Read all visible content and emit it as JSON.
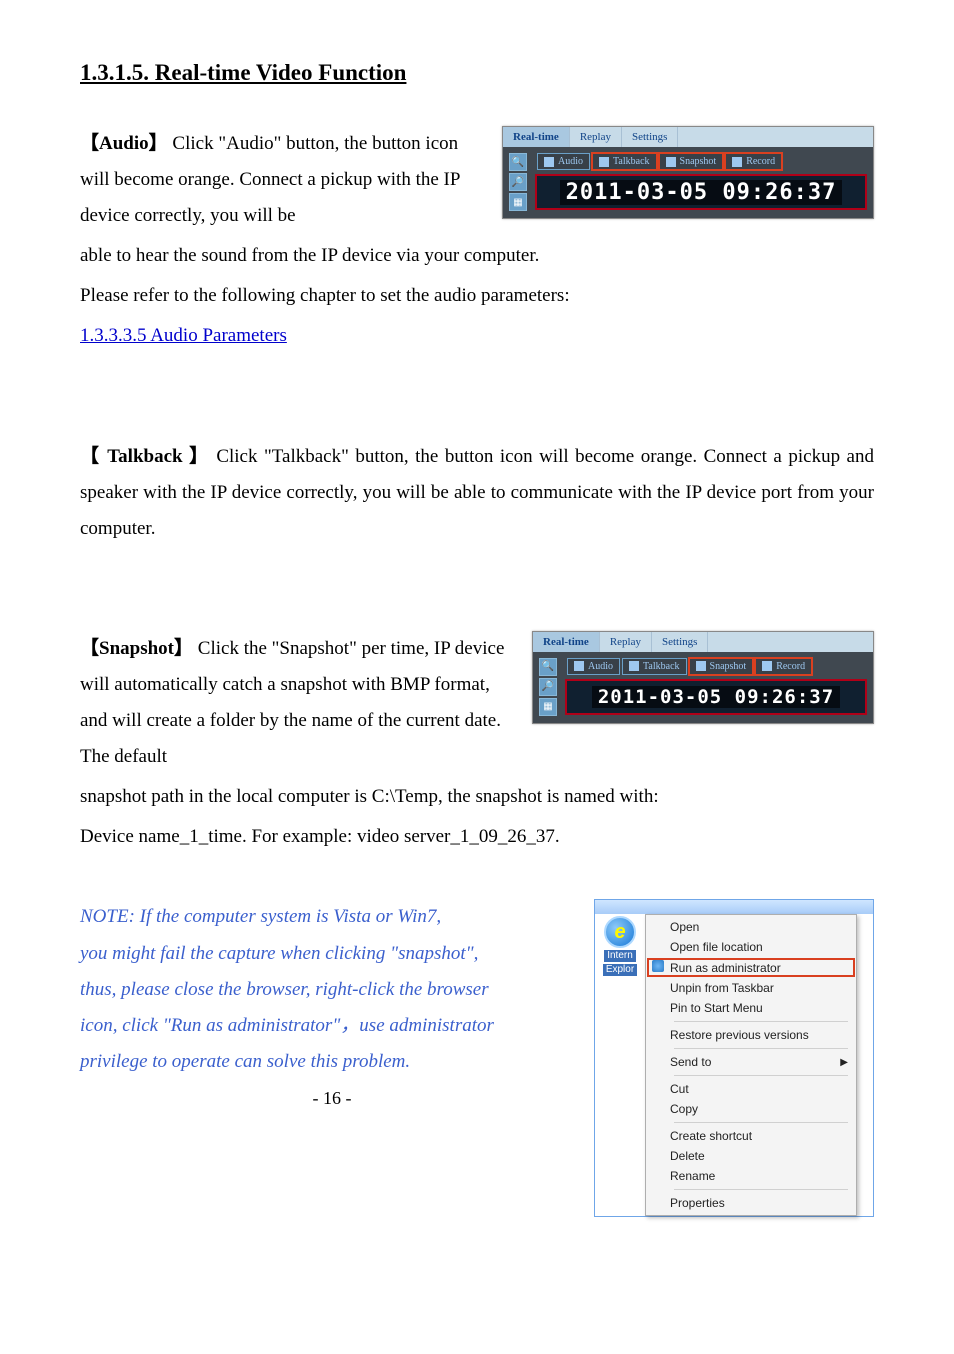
{
  "heading": "1.3.1.5. Real-time Video Function",
  "audio": {
    "label_open": "【",
    "label_text": "Audio",
    "label_close": "】",
    "text1": "Click \"Audio\" button, the button icon will become orange. Connect a pickup with the IP device correctly, you will be",
    "text2": "able to hear the sound from the IP device via your computer.",
    "text3": "Please refer to the following chapter to set the audio parameters:",
    "link": "1.3.3.3.5 Audio Parameters"
  },
  "talkback": {
    "label_open": "【",
    "label_text": " Talkback ",
    "label_close": "】",
    "text": " Click \"Talkback\" button, the button icon will become orange. Connect a pickup and speaker with the IP device correctly, you will be able to communicate with the IP device port from your computer."
  },
  "snapshot": {
    "label_open": "【",
    "label_text": "Snapshot",
    "label_close": "】",
    "text1": "Click the \"Snapshot\" per time,   IP device will automatically catch a snapshot with BMP format, and will create a folder by the name of the current date. The default",
    "text2": "snapshot path in the local computer is C:\\Temp, the snapshot is named with:",
    "text3": "Device name_1_time. For example: video server_1_09_26_37."
  },
  "note": {
    "line1": "NOTE: If the computer system is Vista or Win7,",
    "line2": "you might fail the capture when clicking \"snapshot\",",
    "line3": "thus, please close the browser, right-click the browser",
    "line4": "icon, click \"Run as administrator\"，use administrator",
    "line5": "privilege to operate can solve this problem."
  },
  "page_number": "- 16 -",
  "figure_toolbar": {
    "tabs": {
      "realtime": "Real-time",
      "replay": "Replay",
      "settings": "Settings"
    },
    "buttons": {
      "audio": "Audio",
      "talkback": "Talkback",
      "snapshot": "Snapshot",
      "record": "Record"
    },
    "timestamp": "2011-03-05 09:26:37"
  },
  "context_menu": {
    "ie_label1": "Intern",
    "ie_label2": "Explor",
    "items": {
      "open": "Open",
      "open_location": "Open file location",
      "run_admin": "Run as administrator",
      "unpin": "Unpin from Taskbar",
      "pin_start": "Pin to Start Menu",
      "restore": "Restore previous versions",
      "send_to": "Send to",
      "cut": "Cut",
      "copy": "Copy",
      "shortcut": "Create shortcut",
      "delete": "Delete",
      "rename": "Rename",
      "properties": "Properties"
    }
  }
}
